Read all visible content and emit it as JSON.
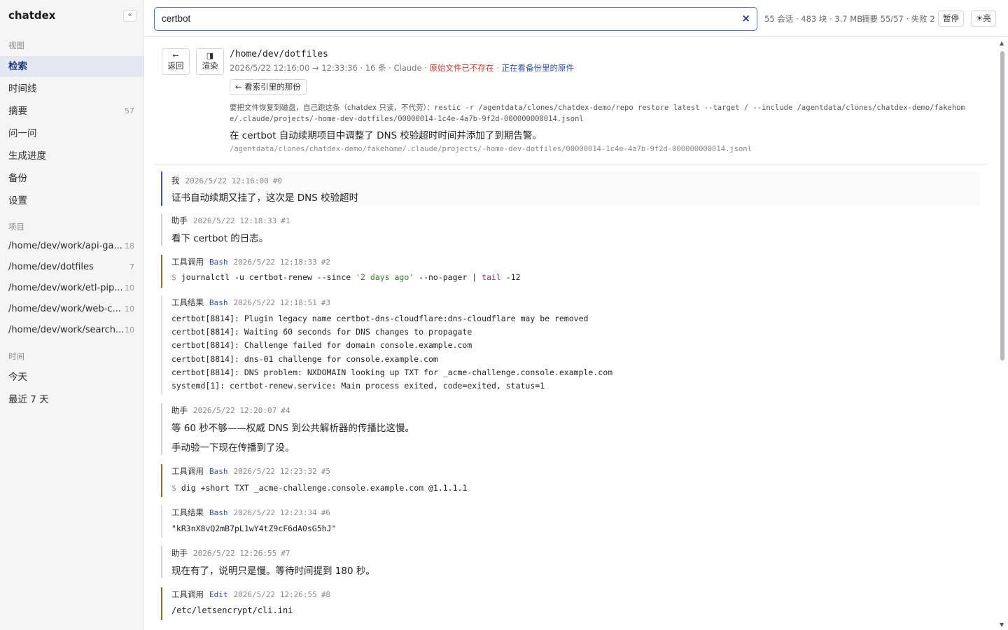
{
  "app": {
    "title": "chatdex",
    "collapse_label": "«"
  },
  "sidebar": {
    "view_label": "视图",
    "nav": [
      {
        "label": "检索",
        "count": ""
      },
      {
        "label": "时间线",
        "count": ""
      },
      {
        "label": "摘要",
        "count": "57"
      },
      {
        "label": "问一问",
        "count": ""
      },
      {
        "label": "生成进度",
        "count": ""
      },
      {
        "label": "备份",
        "count": ""
      },
      {
        "label": "设置",
        "count": ""
      }
    ],
    "projects_label": "项目",
    "projects": [
      {
        "label": "/home/dev/work/api-ga...",
        "count": "18"
      },
      {
        "label": "/home/dev/dotfiles",
        "count": "7"
      },
      {
        "label": "/home/dev/work/etl-pip...",
        "count": "10"
      },
      {
        "label": "/home/dev/work/web-c...",
        "count": "10"
      },
      {
        "label": "/home/dev/work/search...",
        "count": "10"
      }
    ],
    "time_label": "时间",
    "time": [
      {
        "label": "今天"
      },
      {
        "label": "最近 7 天"
      }
    ]
  },
  "topbar": {
    "search_value": "certbot",
    "clear_label": "×",
    "stats": "55 会话 · 483 块 · 3.7 MB",
    "summary_stats": "摘要 55/57 · 失败 2",
    "pause_label": "暂停",
    "theme_label": "☀亮"
  },
  "session": {
    "back_icon": "←",
    "back_label": "返回",
    "render_icon": "◨",
    "render_label": "渲染",
    "path": "/home/dev/dotfiles",
    "meta": "2026/5/22 12:16:00 → 12:33:36 · 16 条 · Claude · ",
    "missing": "原始文件已不存在",
    "meta_sep": " · ",
    "viewing_backup": "正在看备份里的原件",
    "backup_button": "← 看索引里的那份",
    "restore_prefix": "要把文件恢复到磁盘，自己跑这条（chatdex 只读，不代劳）：",
    "restore_cmd": "restic -r /agentdata/clones/chatdex-demo/repo restore latest --target / --include /agentdata/clones/chatdex-demo/fakehome/.claude/projects/-home-dev-dotfiles/00000014-1c4e-4a7b-9f2d-000000000014.jsonl",
    "summary": "在 certbot 自动续期项目中调整了 DNS 校验超时时间并添加了到期告警。",
    "file": "/agentdata/clones/chatdex-demo/fakehome/.claude/projects/-home-dev-dotfiles/00000014-1c4e-4a7b-9f2d-000000000014.jsonl"
  },
  "messages": [
    {
      "role": "我",
      "time": "2026/5/22 12:16:00",
      "idx": "#0",
      "text": "证书自动续期又挂了，这次是 DNS 校验超时"
    },
    {
      "role": "助手",
      "time": "2026/5/22 12:18:33",
      "idx": "#1",
      "text": "看下 certbot 的日志。"
    },
    {
      "role": "工具调用",
      "tool": "Bash",
      "time": "2026/5/22 12:18:33",
      "idx": "#2",
      "cmd_prompt": "$",
      "cmd_a": "journalctl -u certbot-renew --since ",
      "cmd_str": "'2 days ago'",
      "cmd_b": " --no-pager | ",
      "cmd_kw": "tail",
      "cmd_c": " -12"
    },
    {
      "role": "工具结果",
      "tool": "Bash",
      "time": "2026/5/22 12:18:51",
      "idx": "#3",
      "lines": [
        "certbot[8814]: Plugin legacy name certbot-dns-cloudflare:dns-cloudflare may be removed",
        "certbot[8814]: Waiting 60 seconds for DNS changes to propagate",
        "certbot[8814]: Challenge failed for domain console.example.com",
        "certbot[8814]: dns-01 challenge for console.example.com",
        "certbot[8814]: DNS problem: NXDOMAIN looking up TXT for _acme-challenge.console.example.com",
        "systemd[1]: certbot-renew.service: Main process exited, code=exited, status=1"
      ]
    },
    {
      "role": "助手",
      "time": "2026/5/22 12:20:07",
      "idx": "#4",
      "text": "等 60 秒不够——权威 DNS 到公共解析器的传播比这慢。",
      "text2": "手动验一下现在传播到了没。"
    },
    {
      "role": "工具调用",
      "tool": "Bash",
      "time": "2026/5/22 12:23:32",
      "idx": "#5",
      "cmd_prompt": "$",
      "cmd": "dig +short TXT _acme-challenge.console.example.com @1.1.1.1"
    },
    {
      "role": "工具结果",
      "tool": "Bash",
      "time": "2026/5/22 12:23:34",
      "idx": "#6",
      "output": "\"kR3nX8vQ2mB7pL1wY4tZ9cF6dA0sG5hJ\""
    },
    {
      "role": "助手",
      "time": "2026/5/22 12:26:55",
      "idx": "#7",
      "text": "现在有了，说明只是慢。等待时间提到 180 秒。"
    },
    {
      "role": "工具调用",
      "tool": "Edit",
      "time": "2026/5/22 12:26:55",
      "idx": "#8",
      "output": "/etc/letsencrypt/cli.ini"
    }
  ],
  "scrollbar": {
    "up_icon": "▲",
    "down_icon": "▼"
  }
}
